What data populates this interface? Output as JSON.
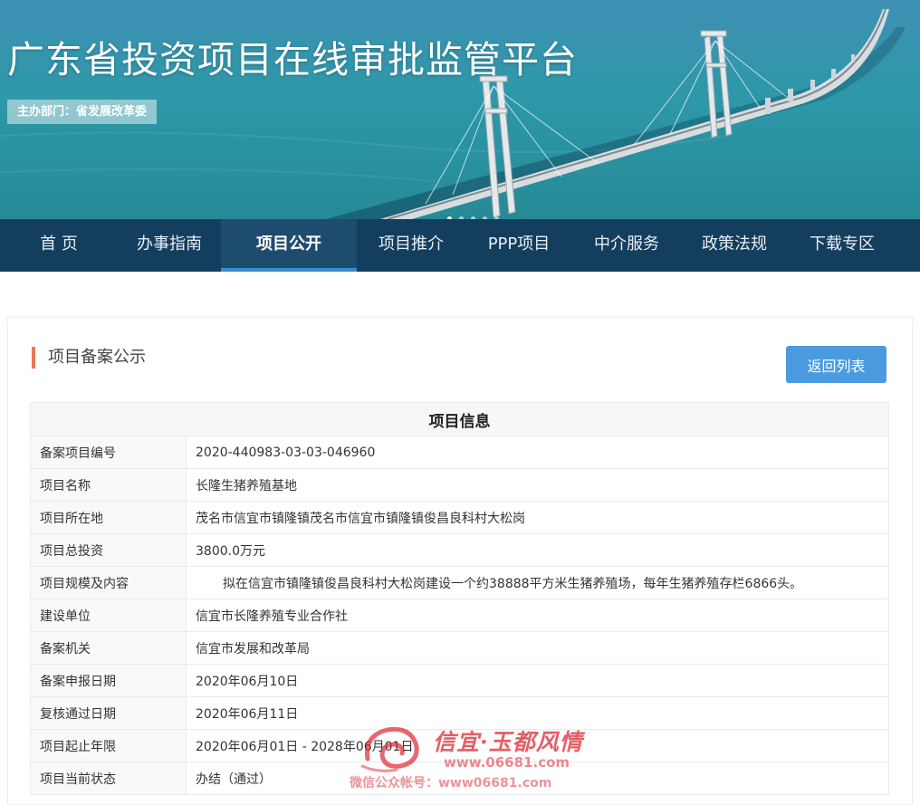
{
  "banner": {
    "title": "广东省投资项目在线审批监管平台",
    "host": "主办部门：省发展改革委"
  },
  "nav": {
    "items": [
      {
        "label": "首 页"
      },
      {
        "label": "办事指南"
      },
      {
        "label": "项目公开",
        "active": true
      },
      {
        "label": "项目推介"
      },
      {
        "label": "PPP项目"
      },
      {
        "label": "中介服务"
      },
      {
        "label": "政策法规"
      },
      {
        "label": "下载专区"
      }
    ]
  },
  "section": {
    "title": "项目备案公示",
    "back_label": "返回列表"
  },
  "table": {
    "header": "项目信息",
    "rows": [
      {
        "label": "备案项目编号",
        "value": "2020-440983-03-03-046960"
      },
      {
        "label": "项目名称",
        "value": "长隆生猪养殖基地"
      },
      {
        "label": "项目所在地",
        "value": "茂名市信宜市镇隆镇茂名市信宜市镇隆镇俊昌良科村大松岗"
      },
      {
        "label": "项目总投资",
        "value": "3800.0万元"
      },
      {
        "label": "项目规模及内容",
        "value": "拟在信宜市镇隆镇俊昌良科村大松岗建设一个约38888平方米生猪养殖场，每年生猪养殖存栏6866头。"
      },
      {
        "label": "建设单位",
        "value": "信宜市长隆养殖专业合作社"
      },
      {
        "label": "备案机关",
        "value": "信宜市发展和改革局"
      },
      {
        "label": "备案申报日期",
        "value": "2020年06月10日"
      },
      {
        "label": "复核通过日期",
        "value": "2020年06月11日"
      },
      {
        "label": "项目起止年限",
        "value": "2020年06月01日 - 2028年06月01日"
      },
      {
        "label": "项目当前状态",
        "value": "办结（通过）"
      }
    ]
  },
  "watermark": {
    "main": "信宜·玉都风情",
    "url": "www.06681.com",
    "sub": "微信公众帐号：www06681.com",
    "color": "#dc2832"
  },
  "colors": {
    "nav_bg": "#143e5e",
    "nav_active_bar": "#3c8ccf",
    "accent_button": "#4a9ae0",
    "section_marker": "#e77a5a"
  }
}
